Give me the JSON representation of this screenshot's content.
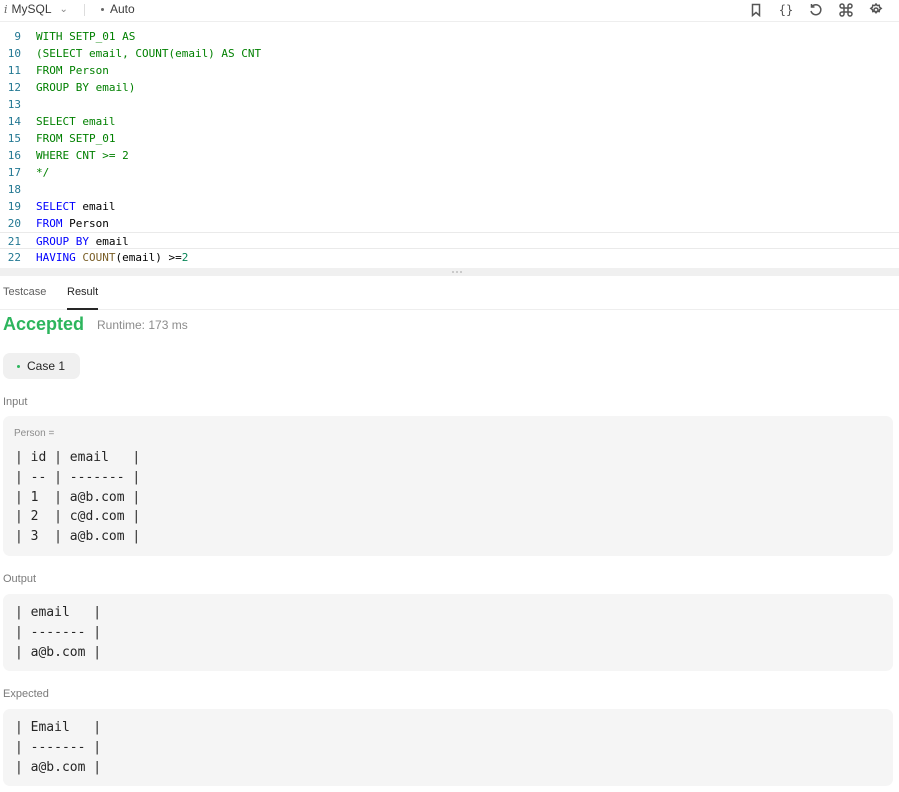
{
  "toolbar": {
    "language": "MySQL",
    "mode": "Auto",
    "icons": [
      "bookmark-icon",
      "braces-icon",
      "reset-icon",
      "command-icon",
      "settings-icon"
    ]
  },
  "editor": {
    "lines": [
      {
        "num": "9",
        "segments": [
          {
            "cls": "cm",
            "text": "WITH SETP_01 AS"
          }
        ]
      },
      {
        "num": "10",
        "segments": [
          {
            "cls": "cm",
            "text": "(SELECT email, COUNT(email) AS CNT"
          }
        ]
      },
      {
        "num": "11",
        "segments": [
          {
            "cls": "cm",
            "text": "FROM Person"
          }
        ]
      },
      {
        "num": "12",
        "segments": [
          {
            "cls": "cm",
            "text": "GROUP BY email)"
          }
        ]
      },
      {
        "num": "13",
        "segments": []
      },
      {
        "num": "14",
        "segments": [
          {
            "cls": "cm",
            "text": "SELECT email"
          }
        ]
      },
      {
        "num": "15",
        "segments": [
          {
            "cls": "cm",
            "text": "FROM SETP_01"
          }
        ]
      },
      {
        "num": "16",
        "segments": [
          {
            "cls": "cm",
            "text": "WHERE CNT >= 2"
          }
        ]
      },
      {
        "num": "17",
        "segments": [
          {
            "cls": "cm",
            "text": "*/"
          }
        ]
      },
      {
        "num": "18",
        "segments": []
      },
      {
        "num": "19",
        "segments": [
          {
            "cls": "kw",
            "text": "SELECT"
          },
          {
            "cls": "plain",
            "text": " email"
          }
        ]
      },
      {
        "num": "20",
        "segments": [
          {
            "cls": "kw",
            "text": "FROM"
          },
          {
            "cls": "plain",
            "text": " Person"
          }
        ]
      },
      {
        "num": "21",
        "current": true,
        "segments": [
          {
            "cls": "kw",
            "text": "GROUP BY"
          },
          {
            "cls": "plain",
            "text": " email"
          }
        ]
      },
      {
        "num": "22",
        "segments": [
          {
            "cls": "kw",
            "text": "HAVING"
          },
          {
            "cls": "plain",
            "text": " "
          },
          {
            "cls": "fn",
            "text": "COUNT"
          },
          {
            "cls": "plain",
            "text": "(email) >="
          },
          {
            "cls": "num",
            "text": "2"
          }
        ]
      }
    ]
  },
  "tabs": [
    {
      "label": "Testcase",
      "active": false
    },
    {
      "label": "Result",
      "active": true
    }
  ],
  "result": {
    "verdict": "Accepted",
    "runtime": "Runtime: 173 ms",
    "case_label": "Case 1",
    "input_label": "Input",
    "input_var": "Person =",
    "input_table": "| id | email   |\n| -- | ------- |\n| 1  | a@b.com |\n| 2  | c@d.com |\n| 3  | a@b.com |",
    "output_label": "Output",
    "output_table": "| email   |\n| ------- |\n| a@b.com |",
    "expected_label": "Expected",
    "expected_table": "| Email   |\n| ------- |\n| a@b.com |"
  },
  "colors": {
    "accepted": "#2db55d",
    "comment": "#008000",
    "keyword": "#0000ff",
    "line_number": "#237893"
  }
}
